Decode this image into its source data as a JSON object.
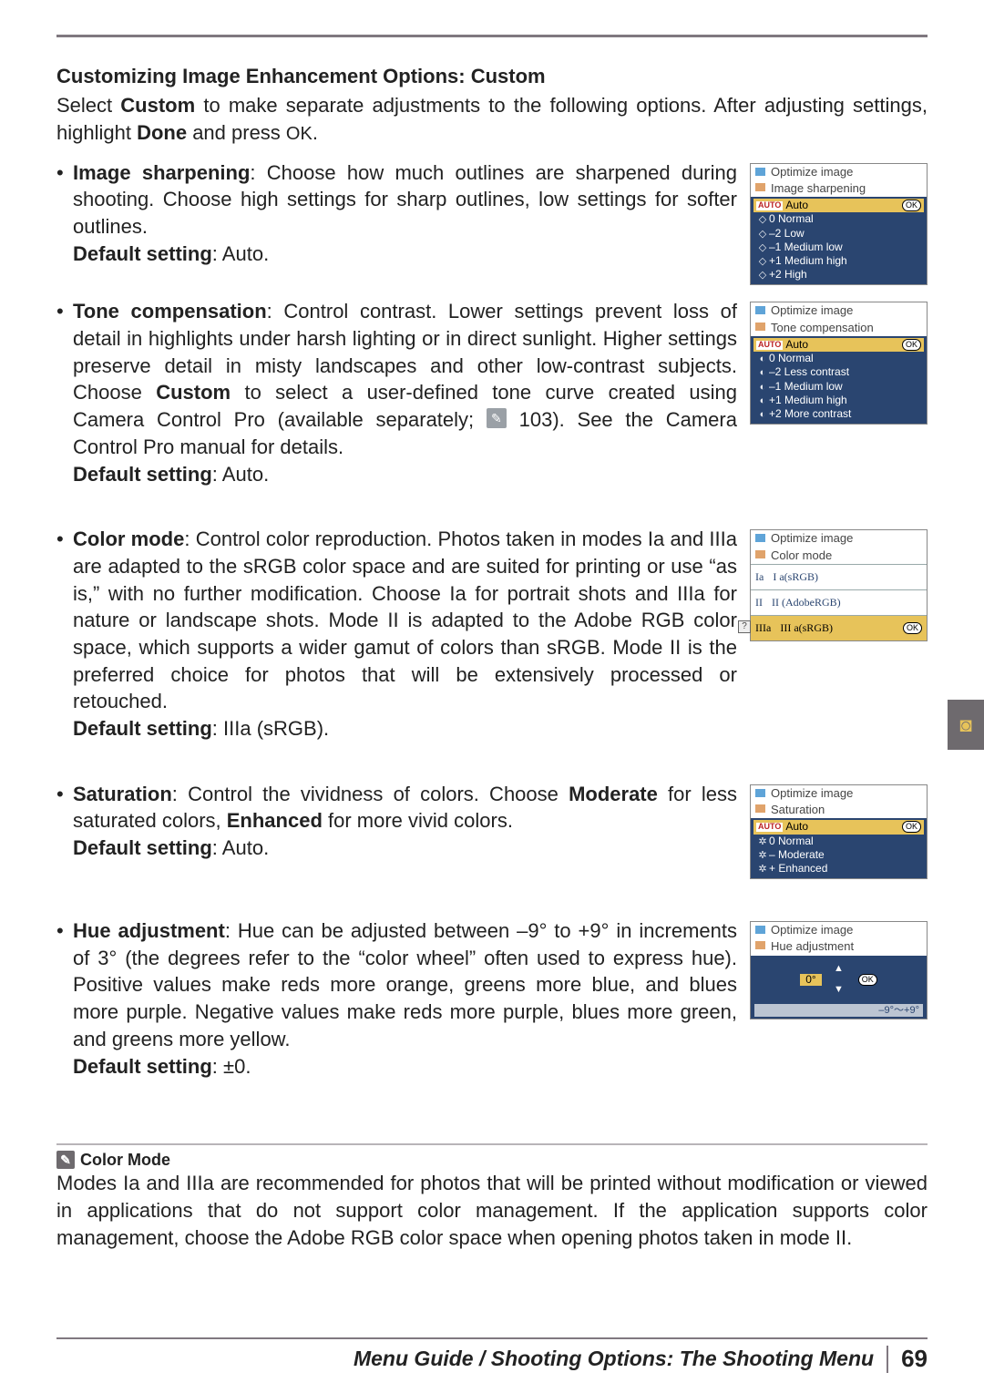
{
  "headings": {
    "section": "Customizing Image Enhancement Options: Custom"
  },
  "lead": {
    "a": "Select ",
    "custom": "Custom",
    "b": " to make separate adjustments to the following options.  After adjusting settings, highlight ",
    "done": "Done",
    "c": " and press ",
    "ok": "OK",
    "d": "."
  },
  "items": {
    "sharpen": {
      "label": "Image sharpening",
      "body": ": Choose how much outlines are sharpened during shooting.  Choose high settings for sharp outlines, low settings for softer outlines.",
      "default_label": "Default setting",
      "default_value": ": Auto."
    },
    "tone": {
      "label": "Tone compensation",
      "body_a": ": Control contrast.  Lower settings prevent loss of detail in highlights under harsh lighting or in direct sunlight.  Higher settings preserve detail in misty landscapes and other low-contrast subjects.  Choose ",
      "custom": "Custom",
      "body_b": " to select a user-defined tone curve created using Camera Control Pro (available separately; ",
      "ref": "103).  See the Camera Control Pro manual for details.",
      "default_label": "Default setting",
      "default_value": ": Auto."
    },
    "color": {
      "label": "Color mode",
      "body": ": Control color reproduction.  Photos taken in modes Ia and IIIa are adapted to the sRGB color space and are suited for printing or use “as is,” with no further modification.  Choose Ia for portrait shots and IIIa for nature or landscape shots.  Mode II is adapted to the Adobe RGB color space, which supports a wider gamut of colors than sRGB.  Mode II is the preferred choice for photos that will be extensively processed or retouched.",
      "default_label": "Default setting",
      "default_value": ": IIIa (sRGB)."
    },
    "sat": {
      "label": "Saturation",
      "body_a": ": Control the vividness of colors.  Choose ",
      "moderate": "Moderate",
      "body_b": " for less saturated colors, ",
      "enhanced": "Enhanced",
      "body_c": " for more vivid colors.",
      "default_label": "Default setting",
      "default_value": ": Auto."
    },
    "hue": {
      "label": "Hue adjustment",
      "body": ": Hue can be adjusted between –9° to +9° in increments of 3° (the degrees refer to the “color wheel” often used to express hue).  Positive values make reds more orange, greens more blue, and blues more purple.  Negative values make reds more purple, blues more green, and greens more yellow.",
      "default_label": "Default setting",
      "default_value": ": ±0."
    }
  },
  "screens": {
    "optimize": "Optimize image",
    "ok": "OK",
    "sharpen": {
      "sub": "Image sharpening",
      "opts": [
        "Auto",
        "0 Normal",
        "–2 Low",
        "–1 Medium low",
        "+1 Medium high",
        "+2 High"
      ]
    },
    "tone": {
      "sub": "Tone compensation",
      "opts": [
        "Auto",
        "0 Normal",
        "–2 Less contrast",
        "–1 Medium low",
        "+1 Medium high",
        "+2 More contrast"
      ]
    },
    "color": {
      "sub": "Color mode",
      "rows": [
        {
          "k": "Ia",
          "v": "I a(sRGB)"
        },
        {
          "k": "II",
          "v": "II (AdobeRGB)"
        },
        {
          "k": "IIIa",
          "v": "III a(sRGB)"
        }
      ]
    },
    "sat": {
      "sub": "Saturation",
      "opts": [
        "Auto",
        "0 Normal",
        "– Moderate",
        "+ Enhanced"
      ]
    },
    "hue": {
      "sub": "Hue adjustment",
      "value": "0°",
      "range": "–9°～+9°"
    }
  },
  "note": {
    "title": "Color Mode",
    "body": "Modes Ia and IIIa are recommended for photos that will be printed without modification or viewed in applications that do not support color management.  If the application supports color management, choose the Adobe RGB color space when opening photos taken in mode II."
  },
  "footer": {
    "text": "Menu Guide / Shooting Options: The Shooting Menu",
    "page": "69"
  }
}
